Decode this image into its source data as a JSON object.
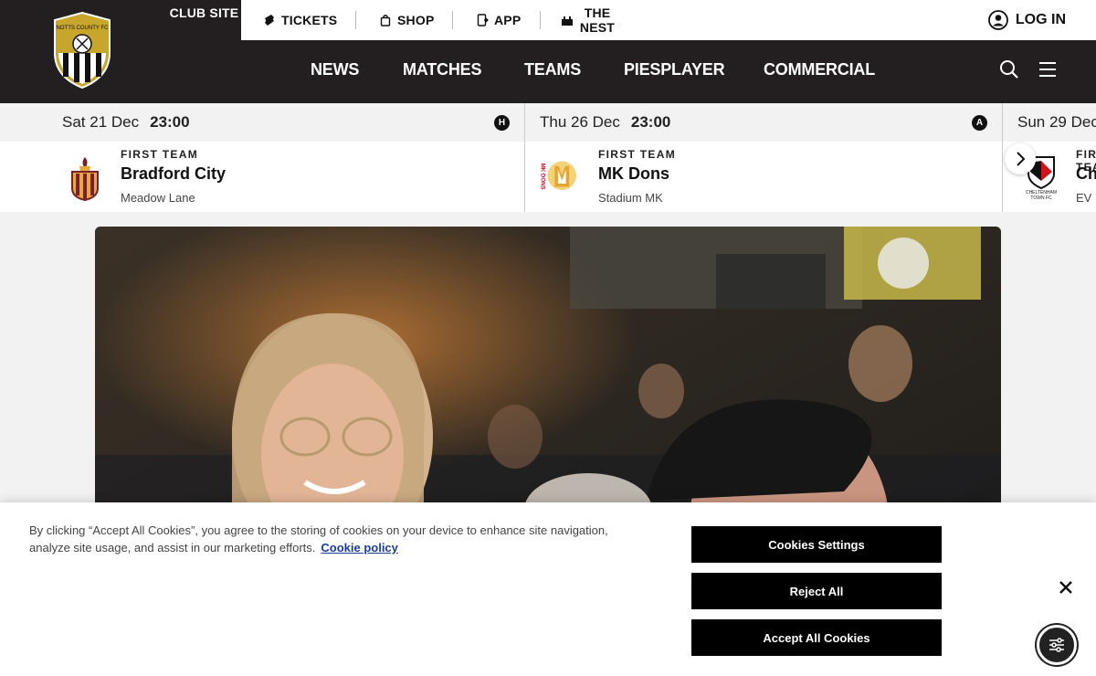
{
  "header": {
    "club_site": "CLUB SITE",
    "top_links": [
      {
        "label": "TICKETS",
        "icon": "ticket-icon"
      },
      {
        "label": "SHOP",
        "icon": "shopping-bag-icon"
      },
      {
        "label": "APP",
        "icon": "phone-app-icon"
      },
      {
        "label": "THE NEST",
        "icon": "stadium-icon"
      }
    ],
    "login_label": "LOG IN",
    "nav": [
      "NEWS",
      "MATCHES",
      "TEAMS",
      "PIESPLAYER",
      "COMMERCIAL"
    ],
    "colors": {
      "bg": "#231f20",
      "accent": "#c7a62b"
    }
  },
  "fixtures": [
    {
      "day": "Sat 21 Dec",
      "time": "23:00",
      "venue_type": "H",
      "team": "FIRST TEAM",
      "opponent": "Bradford City",
      "venue": "Meadow Lane"
    },
    {
      "day": "Thu 26 Dec",
      "time": "23:00",
      "venue_type": "A",
      "team": "FIRST TEAM",
      "opponent": "MK Dons",
      "venue": "Stadium MK"
    },
    {
      "day": "Sun 29 Dec",
      "time": "",
      "venue_type": "",
      "team": "FIRST TEAM",
      "opponent": "Cheltenham Town",
      "venue": "EV"
    }
  ],
  "cookie": {
    "text": "By clicking “Accept All Cookies”, you agree to the storing of cookies on your device to enhance site navigation, analyze site usage, and assist in our marketing efforts.",
    "policy_link": "Cookie policy",
    "settings_label": "Cookies Settings",
    "reject_label": "Reject All",
    "accept_label": "Accept All Cookies"
  }
}
